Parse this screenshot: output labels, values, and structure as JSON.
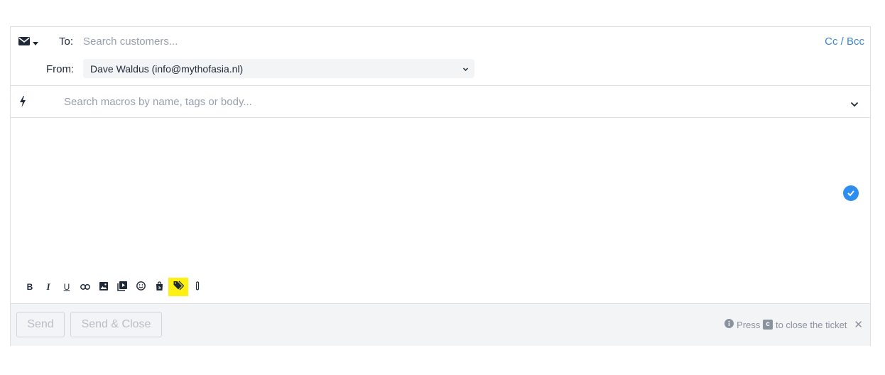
{
  "recipient": {
    "to_label": "To:",
    "to_placeholder": "Search customers...",
    "cc_bcc_label": "Cc / Bcc",
    "from_label": "From:",
    "from_value": "Dave Waldus (info@mythofasia.nl)"
  },
  "channel": {
    "icon": "envelope-icon",
    "dropdown_icon": "caret-down-icon"
  },
  "macros": {
    "icon": "bolt-icon",
    "placeholder": "Search macros by name, tags or body...",
    "chevron_icon": "chevron-down-icon"
  },
  "editor": {
    "body": "",
    "status_icon": "check-circle-icon"
  },
  "toolbar": {
    "bold": "B",
    "italic": "I",
    "underline": "U",
    "items": [
      "bold",
      "italic",
      "underline",
      "link-icon",
      "image-icon",
      "video-icon",
      "emoji-icon",
      "shopify-icon",
      "tag-icon",
      "attachment-icon"
    ],
    "highlighted": "tag-icon"
  },
  "footer": {
    "send_label": "Send",
    "send_close_label": "Send & Close",
    "hint_before": "Press",
    "hint_key": "c",
    "hint_after": "to close the ticket",
    "hint_close": "✕"
  },
  "colors": {
    "accent": "#3c86d8",
    "check": "#2d8ef0",
    "highlight": "#fef013",
    "border": "#dcdfe4",
    "footer_bg": "#f3f4f6"
  }
}
